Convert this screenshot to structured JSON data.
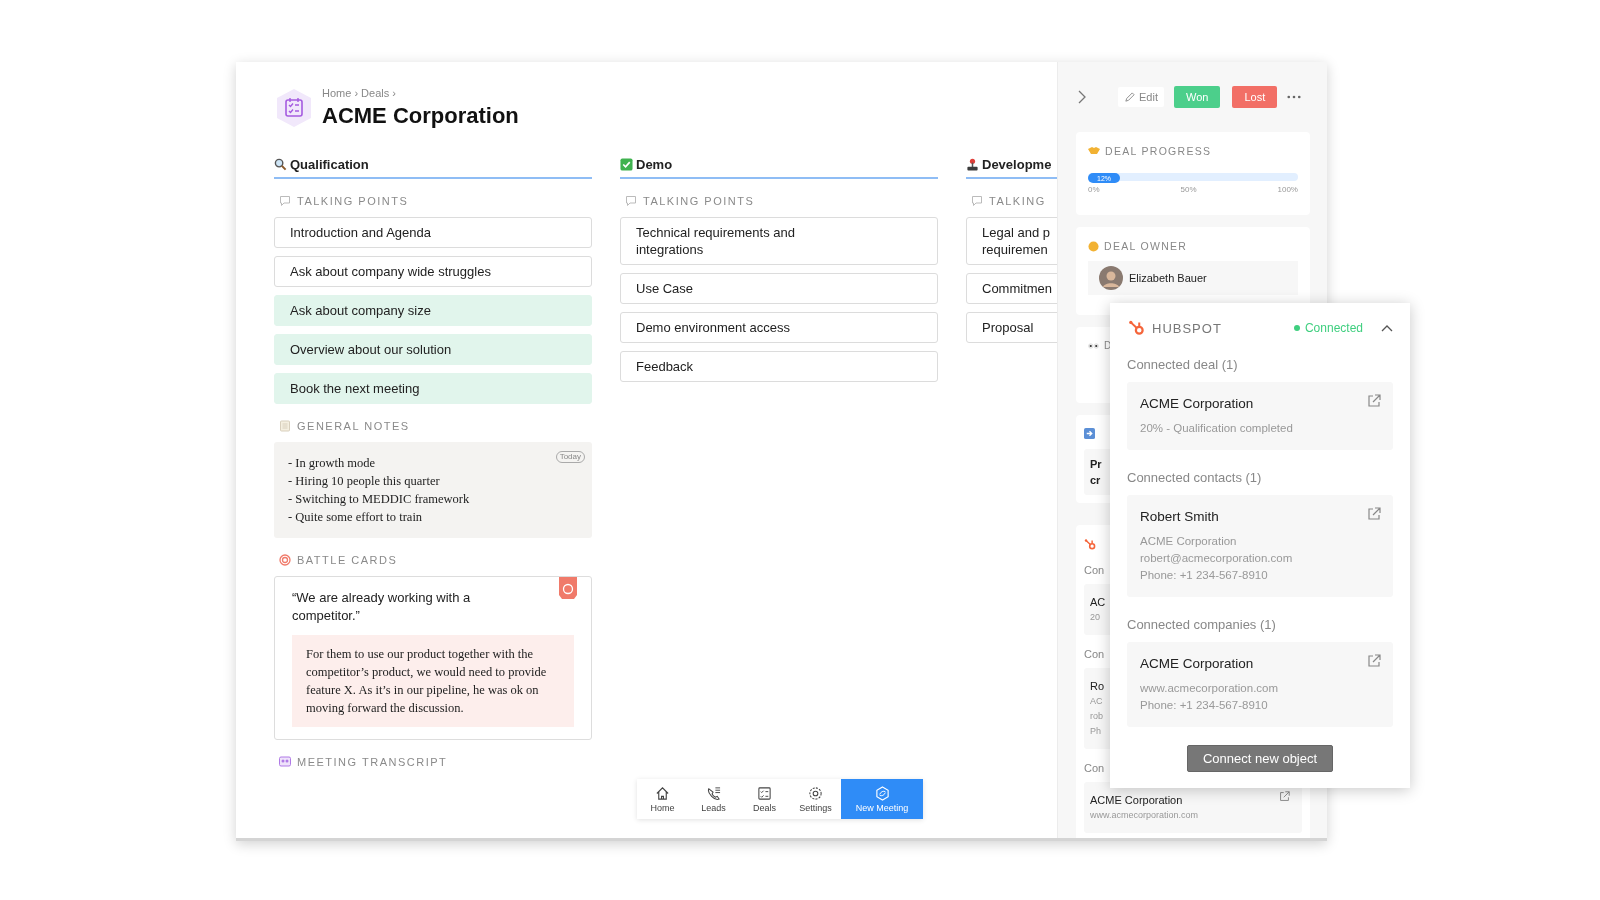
{
  "breadcrumb": "Home › Deals ›",
  "title": "ACME Corporation",
  "columns": [
    {
      "title": "Qualification",
      "talking_points_label": "TALKING POINTS",
      "items": [
        {
          "text": "Introduction and Agenda",
          "done": false
        },
        {
          "text": "Ask about company wide struggles",
          "done": false
        },
        {
          "text": "Ask about company size",
          "done": true
        },
        {
          "text": "Overview about our solution",
          "done": true
        },
        {
          "text": "Book the next meeting",
          "done": true
        }
      ],
      "general_notes": {
        "label": "GENERAL NOTES",
        "badge": "Today",
        "lines": [
          "- In growth mode",
          "- Hiring 10 people this quarter",
          "- Switching to MEDDIC framework",
          "- Quite some effort to train"
        ]
      },
      "battle_cards": {
        "label": "BATTLE CARDS",
        "quote": "“We are already working with a competitor.”",
        "answer": "For them to use our product together with the competitor’s product, we would need to provide feature X. As it’s in our pipeline, he was ok on moving forward the discussion."
      },
      "meeting_transcript": {
        "label": "MEETING TRANSCRIPT"
      }
    },
    {
      "title": "Demo",
      "talking_points_label": "TALKING POINTS",
      "items": [
        {
          "text": "Technical requirements and integrations",
          "done": false
        },
        {
          "text": "Use Case",
          "done": false
        },
        {
          "text": "Demo environment access",
          "done": false
        },
        {
          "text": "Feedback",
          "done": false
        }
      ]
    },
    {
      "title": "Developme",
      "talking_points_label": "TALKING",
      "items": [
        {
          "text": "Legal and p requiremen",
          "done": false
        },
        {
          "text": "Commitmen",
          "done": false
        },
        {
          "text": "Proposal",
          "done": false
        }
      ]
    }
  ],
  "right_panel": {
    "edit": "Edit",
    "won": "Won",
    "lost": "Lost",
    "deal_progress": {
      "label": "DEAL PROGRESS",
      "level": 0.12,
      "reading": "12%",
      "ticks": [
        "0%",
        "50%",
        "100%"
      ]
    },
    "deal_owner": {
      "label": "DEAL OWNER",
      "name": "Elizabeth Bauer"
    },
    "partial_card_label": "D",
    "partial_box_lines": [
      "Pr",
      "cr"
    ],
    "partial_hubspot": [
      {
        "heading": "Con",
        "lines": [
          "AC",
          "20"
        ]
      },
      {
        "heading": "Con",
        "lines": [
          "Ro",
          "AC",
          "rob",
          "Ph"
        ]
      }
    ],
    "last_heading": "Con",
    "last_card": {
      "title": "ACME Corporation",
      "subtitle": "www.acmecorporation.com"
    }
  },
  "popup": {
    "title": "HUBSPOT",
    "status": "Connected",
    "connected": true,
    "expanded": true,
    "sections": [
      {
        "heading": "Connected deal (1)",
        "title": "ACME Corporation",
        "lines": [
          "20% - Qualification completed"
        ]
      },
      {
        "heading": "Connected contacts (1)",
        "title": "Robert Smith",
        "lines": [
          "ACME Corporation",
          "robert@acmecorporation.com",
          "Phone: +1 234-567-8910"
        ]
      },
      {
        "heading": "Connected companies (1)",
        "title": "ACME Corporation",
        "lines": [
          "www.acmecorporation.com",
          "Phone: +1 234-567-8910"
        ]
      }
    ],
    "button": "Connect new object"
  },
  "bottom_nav": [
    {
      "label": "Home",
      "selected": false
    },
    {
      "label": "Leads",
      "selected": false
    },
    {
      "label": "Deals",
      "selected": false
    },
    {
      "label": "Settings",
      "selected": false
    },
    {
      "label": "New Meeting",
      "selected": true
    }
  ]
}
